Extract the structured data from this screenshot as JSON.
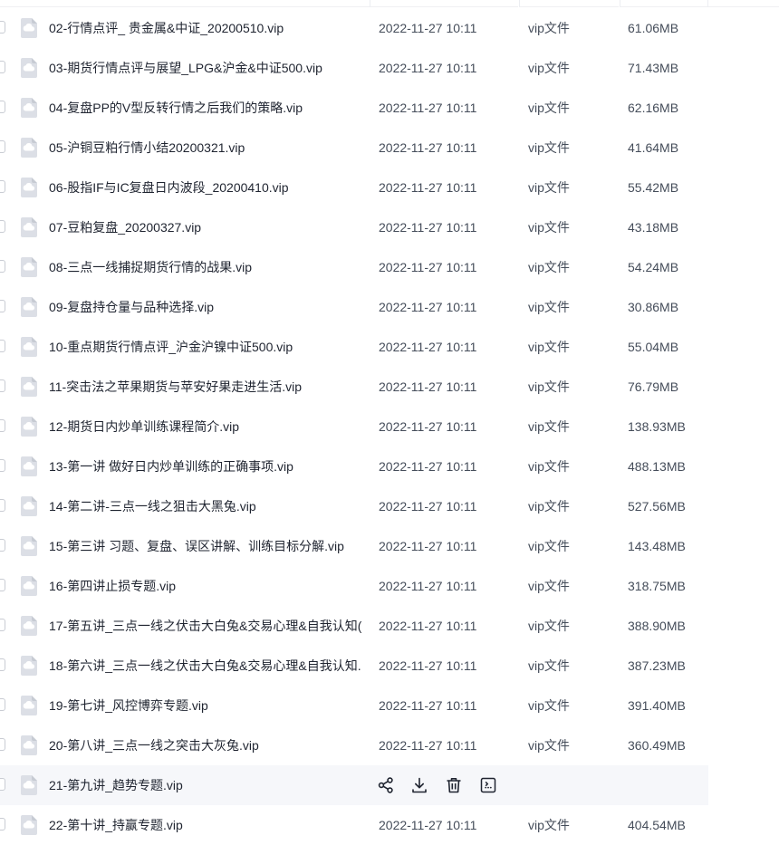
{
  "file_list": {
    "rows": [
      {
        "name": "02-行情点评_ 贵金属&中证_20200510.vip",
        "time": "2022-11-27 10:11",
        "type": "vip文件",
        "size": "61.06MB"
      },
      {
        "name": "03-期货行情点评与展望_LPG&沪金&中证500.vip",
        "time": "2022-11-27 10:11",
        "type": "vip文件",
        "size": "71.43MB"
      },
      {
        "name": "04-复盘PP的V型反转行情之后我们的策略.vip",
        "time": "2022-11-27 10:11",
        "type": "vip文件",
        "size": "62.16MB"
      },
      {
        "name": "05-沪铜豆粕行情小结20200321.vip",
        "time": "2022-11-27 10:11",
        "type": "vip文件",
        "size": "41.64MB"
      },
      {
        "name": "06-股指IF与IC复盘日内波段_20200410.vip",
        "time": "2022-11-27 10:11",
        "type": "vip文件",
        "size": "55.42MB"
      },
      {
        "name": "07-豆粕复盘_20200327.vip",
        "time": "2022-11-27 10:11",
        "type": "vip文件",
        "size": "43.18MB"
      },
      {
        "name": "08-三点一线捕捉期货行情的战果.vip",
        "time": "2022-11-27 10:11",
        "type": "vip文件",
        "size": "54.24MB"
      },
      {
        "name": "09-复盘持仓量与品种选择.vip",
        "time": "2022-11-27 10:11",
        "type": "vip文件",
        "size": "30.86MB"
      },
      {
        "name": "10-重点期货行情点评_沪金沪镍中证500.vip",
        "time": "2022-11-27 10:11",
        "type": "vip文件",
        "size": "55.04MB"
      },
      {
        "name": "11-突击法之苹果期货与苹安好果走进生活.vip",
        "time": "2022-11-27 10:11",
        "type": "vip文件",
        "size": "76.79MB"
      },
      {
        "name": "12-期货日内炒单训练课程简介.vip",
        "time": "2022-11-27 10:11",
        "type": "vip文件",
        "size": "138.93MB"
      },
      {
        "name": "13-第一讲   做好日内炒单训练的正确事项.vip",
        "time": "2022-11-27 10:11",
        "type": "vip文件",
        "size": "488.13MB"
      },
      {
        "name": "14-第二讲-三点一线之狙击大黑兔.vip",
        "time": "2022-11-27 10:11",
        "type": "vip文件",
        "size": "527.56MB"
      },
      {
        "name": "15-第三讲 习题、复盘、误区讲解、训练目标分解.vip",
        "time": "2022-11-27 10:11",
        "type": "vip文件",
        "size": "143.48MB"
      },
      {
        "name": "16-第四讲止损专题.vip",
        "time": "2022-11-27 10:11",
        "type": "vip文件",
        "size": "318.75MB"
      },
      {
        "name": "17-第五讲_三点一线之伏击大白兔&交易心理&自我认知(...",
        "time": "2022-11-27 10:11",
        "type": "vip文件",
        "size": "388.90MB"
      },
      {
        "name": "18-第六讲_三点一线之伏击大白兔&交易心理&自我认知...",
        "time": "2022-11-27 10:11",
        "type": "vip文件",
        "size": "387.23MB"
      },
      {
        "name": "19-第七讲_风控博弈专题.vip",
        "time": "2022-11-27 10:11",
        "type": "vip文件",
        "size": "391.40MB"
      },
      {
        "name": "20-第八讲_三点一线之突击大灰兔.vip",
        "time": "2022-11-27 10:11",
        "type": "vip文件",
        "size": "360.49MB"
      },
      {
        "name": "21-第九讲_趋势专题.vip",
        "hover": true,
        "actions": [
          "share-icon",
          "download-icon",
          "delete-icon",
          "more-icon"
        ]
      },
      {
        "name": "22-第十讲_持赢专题.vip",
        "time": "2022-11-27 10:11",
        "type": "vip文件",
        "size": "404.54MB"
      }
    ]
  },
  "colors": {
    "hover_row_bg": "#f6f7fa",
    "text_primary": "#1f2430",
    "text_secondary": "#454d5a",
    "icon_gray": "#dcdfe6"
  }
}
